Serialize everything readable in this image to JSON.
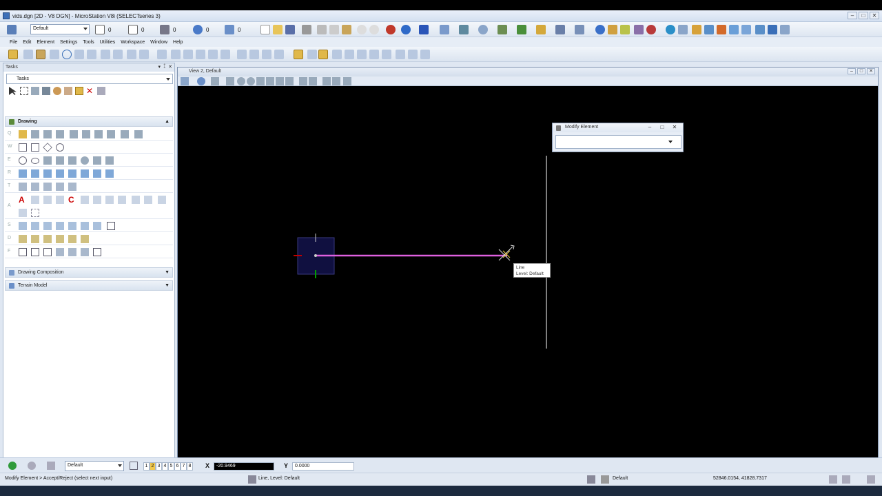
{
  "window": {
    "title": "vids.dgn [2D - V8 DGN] - MicroStation V8i (SELECTseries 3)",
    "min": "–",
    "max": "□",
    "close": "✕"
  },
  "toolbar": {
    "level_combo": "Default",
    "num_a": "0",
    "num_b": "0",
    "num_c": "0",
    "num_d": "0",
    "num_e": "0"
  },
  "menu": [
    "File",
    "Edit",
    "Element",
    "Settings",
    "Tools",
    "Utilities",
    "Workspace",
    "Window",
    "Help"
  ],
  "tasks": {
    "panel_title": "Tasks",
    "combo_value": "Tasks",
    "sections": {
      "drawing": "Drawing",
      "drawing_composition": "Drawing Composition",
      "terrain_model": "Terrain Model"
    },
    "row_keys": [
      "Q",
      "W",
      "E",
      "R",
      "T",
      "A",
      "S",
      "D",
      "F"
    ]
  },
  "view": {
    "title": "View 2, Default"
  },
  "dialog": {
    "title": "Modify Element",
    "combo_value": ""
  },
  "tooltip": {
    "line1": "Line",
    "line2": "Level: Default"
  },
  "status": {
    "level_combo": "Default",
    "pages": [
      "1",
      "2",
      "3",
      "4",
      "5",
      "6",
      "7",
      "8"
    ],
    "x_label": "X",
    "x_value": "-20.9469",
    "y_label": "Y",
    "y_value": "0.0000",
    "prompt": "Modify Element > Accept/Reject (select next input)",
    "element_info": "Line, Level: Default",
    "active_level": "Default",
    "coordinates": "52846.0154, 41828.7317"
  },
  "colors": {
    "line": "#e060e0",
    "selection_box": "#101040",
    "x_axis": "#c00000",
    "y_axis": "#00a000"
  }
}
